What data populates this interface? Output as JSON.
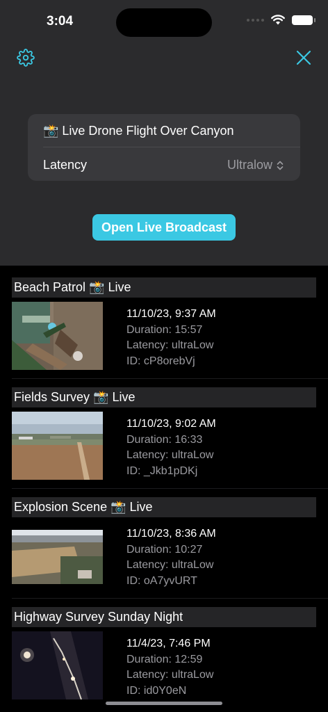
{
  "status_bar": {
    "time": "3:04"
  },
  "header": {
    "settings_icon": "gear-icon",
    "close_icon": "close-icon",
    "accent_color": "#3bc8e3"
  },
  "stream_card": {
    "title": "📸 Live Drone Flight Over Canyon",
    "latency_label": "Latency",
    "latency_value": "Ultralow"
  },
  "broadcast_button": {
    "label": "Open Live Broadcast"
  },
  "recordings": [
    {
      "title": "Beach Patrol 📸 Live",
      "date": "11/10/23, 9:37 AM",
      "duration": "Duration: 15:57",
      "latency": "Latency: ultraLow",
      "id": "ID: cP8orebVj"
    },
    {
      "title": "Fields Survey 📸 Live",
      "date": "11/10/23, 9:02 AM",
      "duration": "Duration: 16:33",
      "latency": "Latency: ultraLow",
      "id": "ID: _Jkb1pDKj"
    },
    {
      "title": "Explosion Scene 📸 Live",
      "date": "11/10/23, 8:36 AM",
      "duration": "Duration: 10:27",
      "latency": "Latency: ultraLow",
      "id": "ID: oA7yvURT"
    },
    {
      "title": "Highway Survey Sunday Night",
      "date": "11/4/23, 7:46 PM",
      "duration": "Duration: 12:59",
      "latency": "Latency: ultraLow",
      "id": "ID: id0Y0eN"
    }
  ]
}
